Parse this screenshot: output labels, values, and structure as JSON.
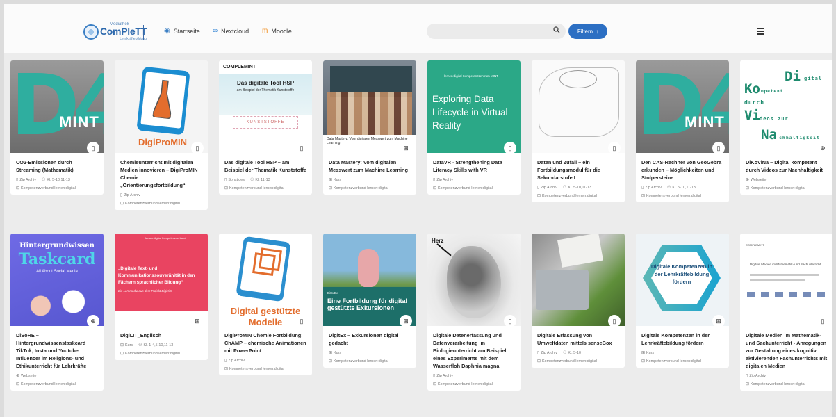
{
  "header": {
    "logo_sup": "Mediathek",
    "logo_main": "ComPleTT",
    "logo_sub": "Lehrkräftebildung",
    "nav": [
      {
        "label": "Startseite",
        "icon": "logo-icon"
      },
      {
        "label": "Nextcloud",
        "icon": "cloud-icon"
      },
      {
        "label": "Moodle",
        "icon": "moodle-icon"
      }
    ],
    "search_placeholder": "",
    "filter_label": "Filtern",
    "filter_icon": "↑"
  },
  "thumbs": {
    "d4": "D4",
    "mint": "MINT",
    "digipromin": "DigiProMIN",
    "hsp_head": "COMPLEMINT",
    "hsp_t1": "Das digitale Tool HSP",
    "hsp_t2": "am Beispiel der Thematik Kunststoffe",
    "hsp_strip": "KUNSTSTOFFE",
    "ml_caption": "Data Mastery: Vom digitalen Messwert zum Machine Learning",
    "vr_label": "lernen:digital Kompetenzzentrum MINT",
    "vr_big": "Exploring Data Lifecycle in Virtual Reality",
    "dk": [
      "Di",
      "gital",
      "Ko",
      "mpetent",
      "durch",
      "Vi",
      "deos zur",
      "Na",
      "chhaltigkeit"
    ],
    "task_l1": "Hintergrundwissen",
    "task_l2": "Taskcard",
    "task_l3": "All About Social Media",
    "pink_hd": "lernen:digital Kompetenzverbund",
    "pink_q": "„Digitale Text- und Kommunikationssouveränität in den Fächern sprachlicher Bildung“",
    "pink_sub": "Ein Lernmodul aus dem Projekt DigiKiS",
    "cube_t": "Digital gestützte Modelle",
    "exk_s": "DiExEx",
    "exk_b": "Eine Fortbildung für digital gestützte Exkursionen",
    "herz": "Herz",
    "hex_t": "Digitale Kompetenzen in der Lehrkräftebildung fördern",
    "doc_h": "COMPLEMINT",
    "doc_t": "Digitale Medien im Mathematik- und Sachunterricht"
  },
  "cards": [
    {
      "title": "CO2-Emissionen durch Streaming (Mathematik)",
      "type": "Zip Archiv",
      "grade": "Kl. 5-10,11-13",
      "source": "Kompetenzverbund lernen:digital",
      "badge": "▯"
    },
    {
      "title": "Chemieunterricht mit digitalen Medien innovieren – DigiProMIN Chemie „Orientierungsfortbildung“",
      "type": "Zip Archiv",
      "grade": "",
      "source": "Kompetenzverbund lernen:digital",
      "badge": "▯"
    },
    {
      "title": "Das digitale Tool HSP – am Beispiel der Thematik Kunststoffe",
      "type": "Sonstiges",
      "grade": "Kl. 11-13",
      "source": "Kompetenzverbund lernen:digital",
      "badge": "▯"
    },
    {
      "title": "Data Mastery: Vom digitalen Messwert zum Machine Learning",
      "type": "Kurs",
      "grade": "",
      "source": "Kompetenzverbund lernen:digital",
      "badge": "⊞"
    },
    {
      "title": "DataVR - Strengthening Data Literacy Skills with VR",
      "type": "Zip Archiv",
      "grade": "",
      "source": "Kompetenzverbund lernen:digital",
      "badge": "▯"
    },
    {
      "title": "Daten und Zufall – ein Fortbildungsmodul für die Sekundarstufe I",
      "type": "Zip Archiv",
      "grade": "Kl. 5-10,11-13",
      "source": "Kompetenzverbund lernen:digital",
      "badge": "▯"
    },
    {
      "title": "Den CAS-Rechner von GeoGebra erkunden – Möglichkeiten und Stolpersteine",
      "type": "Zip Archiv",
      "grade": "Kl. 5-10,11-13",
      "source": "Kompetenzverbund lernen:digital",
      "badge": "▯"
    },
    {
      "title": "DiKoViNa – Digital kompetent durch Videos zur Nachhaltigkeit",
      "type": "Webseite",
      "grade": "",
      "source": "Kompetenzverbund lernen:digital",
      "badge": "⊕"
    },
    {
      "title": "DiSoRE – Hintergrundwissenstaskcard TikTok, Insta und Youtube: Influencer im Religions- und Ethikunterricht für Lehrkräfte",
      "type": "Webseite",
      "grade": "",
      "source": "Kompetenzverbund lernen:digital",
      "badge": "⊕"
    },
    {
      "title": "DigiLIT_Englisch",
      "type": "Kurs",
      "grade": "Kl. 1-4,5-10,11-13",
      "source": "Kompetenzverbund lernen:digital",
      "badge": "⊞"
    },
    {
      "title": "DigiProMIN Chemie Fortbildung: ChAMP – chemische Animationen mit PowerPoint",
      "type": "Zip Archiv",
      "grade": "",
      "source": "Kompetenzverbund lernen:digital",
      "badge": "▯"
    },
    {
      "title": "DigitEx – Exkursionen digital gedacht",
      "type": "Kurs",
      "grade": "",
      "source": "Kompetenzverbund lernen:digital",
      "badge": "⊞"
    },
    {
      "title": "Digitale Datenerfassung und Datenverarbeitung im Biologieunterricht am Beispiel eines Experiments mit dem Wasserfloh Daphnia magna",
      "type": "Zip Archiv",
      "grade": "",
      "source": "Kompetenzverbund lernen:digital",
      "badge": "▯"
    },
    {
      "title": "Digitale Erfassung von Umweltdaten mittels senseBox",
      "type": "Zip Archiv",
      "grade": "Kl. 5-10",
      "source": "Kompetenzverbund lernen:digital",
      "badge": "▯"
    },
    {
      "title": "Digitale Kompetenzen in der Lehrkräftebildung fördern",
      "type": "Kurs",
      "grade": "",
      "source": "Kompetenzverbund lernen:digital",
      "badge": "⊞"
    },
    {
      "title": "Digitale Medien im Mathematik- und Sachunterricht - Anregungen zur Gestaltung eines kognitiv aktivierenden Fachunterrichts mit digitalen Medien",
      "type": "Zip Archiv",
      "grade": "",
      "source": "Kompetenzverbund lernen:digital",
      "badge": "▯"
    }
  ],
  "colors": {
    "accent": "#2c6fc3",
    "mint_green": "#2fae9f",
    "brand_blue": "#2d69ad"
  }
}
